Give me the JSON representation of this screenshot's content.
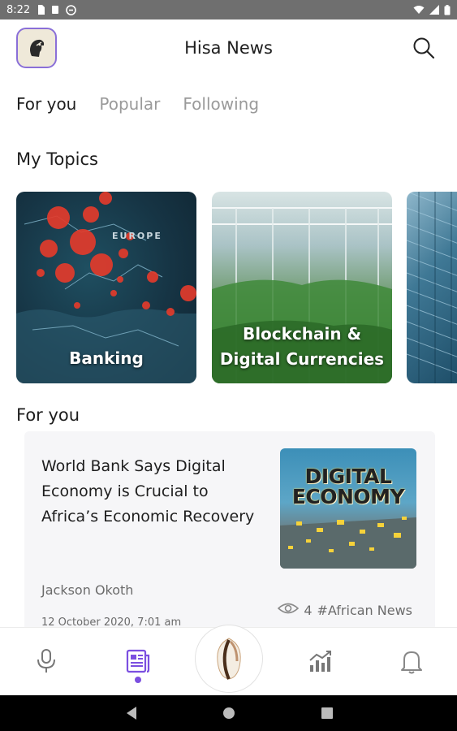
{
  "status_bar": {
    "time": "8:22"
  },
  "header": {
    "title": "Hisa News",
    "logo_icon": "mascot-logo-icon",
    "search_icon": "search-icon"
  },
  "tabs": [
    {
      "label": "For you",
      "active": true
    },
    {
      "label": "Popular",
      "active": false
    },
    {
      "label": "Following",
      "active": false
    }
  ],
  "my_topics": {
    "title": "My Topics",
    "cards": [
      {
        "label": "Banking"
      },
      {
        "label": "Blockchain &",
        "label_line2": "Digital Currencies"
      },
      {
        "label": ""
      }
    ]
  },
  "for_you": {
    "title": "For you",
    "article": {
      "title": "World Bank Says Digital Economy is Crucial to Africa’s Economic Recovery",
      "thumbnail_text_line1": "DIGITAL",
      "thumbnail_text_line2": "ECONOMY",
      "author": "Jackson Okoth",
      "date": "12 October 2020, 7:01 am",
      "views": "4",
      "tag": "#African News"
    }
  },
  "bottom_nav": {
    "items": [
      "podcast-mic-icon",
      "news-article-icon",
      "shell-logo-icon",
      "market-chart-icon",
      "notification-bell-icon"
    ],
    "active_index": 1
  },
  "colors": {
    "accent": "#7b4fe0",
    "status_bar": "#6f6f6f",
    "text": "#1e1e1e",
    "muted": "#9a9a9a"
  }
}
